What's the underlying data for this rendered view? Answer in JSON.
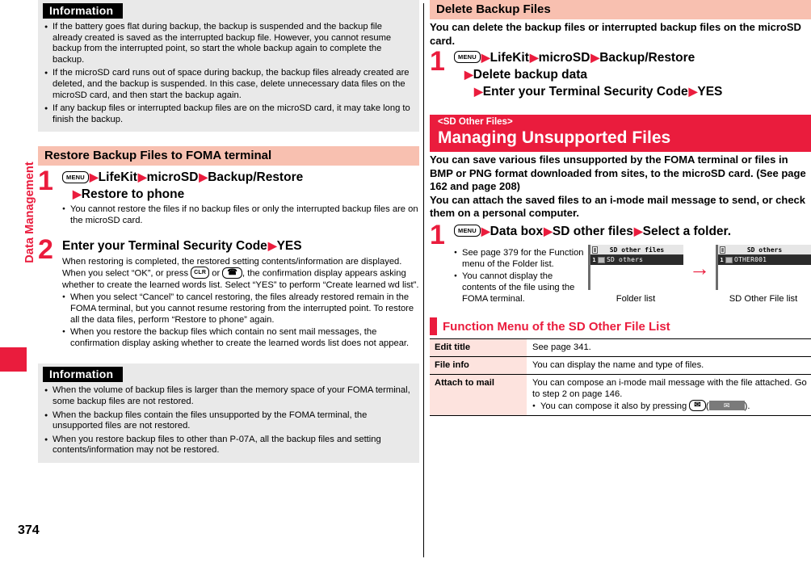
{
  "page": {
    "number": "374",
    "side_tab": "Data Management"
  },
  "left": {
    "info_top": {
      "title": "Information",
      "items": [
        "If the battery goes flat during backup, the backup is suspended and the backup file already created is saved as the interrupted backup file. However, you cannot resume backup from the interrupted point, so start the whole backup again to complete the backup.",
        "If the microSD card runs out of space during backup, the backup files already created are deleted, and the backup is suspended. In this case, delete unnecessary data files on the microSD card, and then start the backup again.",
        "If any backup files or interrupted backup files are on the microSD card, it may take long to finish the backup."
      ]
    },
    "section": {
      "heading": "Restore Backup Files to FOMA terminal"
    },
    "step1": {
      "number": "1",
      "key_menu": "MENU",
      "parts": [
        "LifeKit",
        "microSD",
        "Backup/Restore"
      ],
      "line2": "Restore to phone",
      "bullets": [
        "You cannot restore the files if no backup files or only the interrupted backup files are on the microSD card."
      ]
    },
    "step2": {
      "number": "2",
      "head_pre": "Enter your Terminal Security Code",
      "head_post": "YES",
      "body_a": "When restoring is completed, the restored setting contents/information are displayed. When you select “OK”, or press",
      "key_clr": "CLR",
      "body_b": "or",
      "key_end": "☎",
      "body_c": ", the confirmation display appears asking whether to create the learned words list. Select “YES” to perform “Create learned wd list”.",
      "bullets": [
        "When you select “Cancel” to cancel restoring, the files already restored remain in the FOMA terminal, but you cannot resume restoring from the interrupted point. To restore all the data files, perform “Restore to phone” again.",
        "When you restore the backup files which contain no sent mail messages, the confirmation display asking whether to create the learned words list does not appear."
      ]
    },
    "info_bottom": {
      "title": "Information",
      "items": [
        "When the volume of backup files is larger than the memory space of your FOMA terminal, some backup files are not restored.",
        "When the backup files contain the files unsupported by the FOMA terminal, the unsupported files are not restored.",
        "When you restore backup files to other than P-07A, all the backup files and setting contents/information may not be restored."
      ]
    }
  },
  "right": {
    "section_delete": {
      "heading": "Delete Backup Files",
      "lead": "You can delete the backup files or interrupted backup files on the microSD card.",
      "step": {
        "number": "1",
        "key_menu": "MENU",
        "parts": [
          "LifeKit",
          "microSD",
          "Backup/Restore"
        ],
        "line2": "Delete backup data",
        "line3_pre": "Enter your Terminal Security Code",
        "line3_post": "YES"
      }
    },
    "section_sdother": {
      "sub_heading": "<SD Other Files>",
      "heading": "Managing Unsupported Files",
      "lead1": "You can save various files unsupported by the FOMA terminal or files in BMP or PNG format downloaded from sites, to the microSD card. (See page 162 and page 208)",
      "lead2": "You can attach the saved files to an i-mode mail message to send, or check them on a personal computer.",
      "step": {
        "number": "1",
        "key_menu": "MENU",
        "parts": [
          "Data box",
          "SD other files",
          "Select a folder."
        ],
        "bullets": [
          "See page 379 for the Function menu of the Folder list.",
          "You cannot display the contents of the file using the FOMA terminal."
        ]
      },
      "screens": {
        "folder_list": {
          "title": "SD other files",
          "row_index": "1",
          "row_label": "SD others",
          "caption": "Folder list"
        },
        "file_list": {
          "title": "SD others",
          "row_index": "1",
          "row_label": "OTHER001",
          "caption": "SD Other File list"
        },
        "arrow": "→"
      }
    },
    "function_menu": {
      "heading": "Function Menu of the SD Other File List",
      "rows": [
        {
          "key": "Edit title",
          "value": "See page 341.",
          "bullets": []
        },
        {
          "key": "File info",
          "value": "You can display the name and type of files.",
          "bullets": []
        },
        {
          "key": "Attach to mail",
          "value": "You can compose an i-mode mail message with the file attached. Go to step 2 on page 146.",
          "bullets": [
            "You can compose it also by pressing"
          ],
          "bullet_key": "✉",
          "bullet_softkey": "✉",
          "bullet_tail": ")."
        }
      ]
    }
  },
  "colors": {
    "brand_red": "#ea1c3d",
    "heading_pink": "#f8c0b0",
    "table_key_bg": "#fde3de",
    "info_bg": "#e9e9e9"
  }
}
